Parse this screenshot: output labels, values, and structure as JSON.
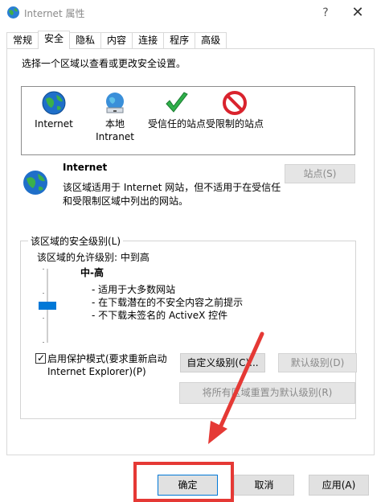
{
  "window": {
    "title": "Internet 属性",
    "help_glyph": "?",
    "close_glyph": "✕",
    "title_icon": "ie-globe-icon"
  },
  "tabs": [
    {
      "label": "常规",
      "active": false
    },
    {
      "label": "安全",
      "active": true
    },
    {
      "label": "隐私",
      "active": false
    },
    {
      "label": "内容",
      "active": false
    },
    {
      "label": "连接",
      "active": false
    },
    {
      "label": "程序",
      "active": false
    },
    {
      "label": "高级",
      "active": false
    }
  ],
  "security": {
    "instruction": "选择一个区域以查看或更改安全设置。",
    "zones": [
      {
        "label": "Internet",
        "icon": "globe-icon",
        "selected": true
      },
      {
        "label": "本地\nIntranet",
        "icon": "intranet-icon",
        "selected": false
      },
      {
        "label": "受信任的站点",
        "icon": "checkmark-icon",
        "selected": false
      },
      {
        "label": "受限制的站点",
        "icon": "restricted-icon",
        "selected": false
      }
    ],
    "selected_zone": {
      "title": "Internet",
      "description": "该区域适用于 Internet 网站，但不适用于在受信任和受限制区域中列出的网站。",
      "sites_button": "站点(S)"
    },
    "level_group": {
      "title": "该区域的安全级别(L)",
      "allowed_levels": "该区域的允许级别: 中到高",
      "level_name": "中-高",
      "level_points": [
        "- 适用于大多数网站",
        "- 在下载潜在的不安全内容之前提示",
        "- 不下载未签名的 ActiveX 控件"
      ],
      "slider_fraction": 0.5,
      "protected_mode_label": "启用保护模式(要求重新启动 Internet Explorer)(P)",
      "protected_mode_checked": true,
      "checkmark": "✓",
      "custom_level_button": "自定义级别(C)...",
      "default_level_button": "默认级别(D)"
    },
    "reset_all_button": "将所有区域重置为默认级别(R)"
  },
  "footer": {
    "ok": "确定",
    "cancel": "取消",
    "apply": "应用(A)"
  },
  "colors": {
    "accent": "#0078d7",
    "highlight": "#e53935"
  }
}
